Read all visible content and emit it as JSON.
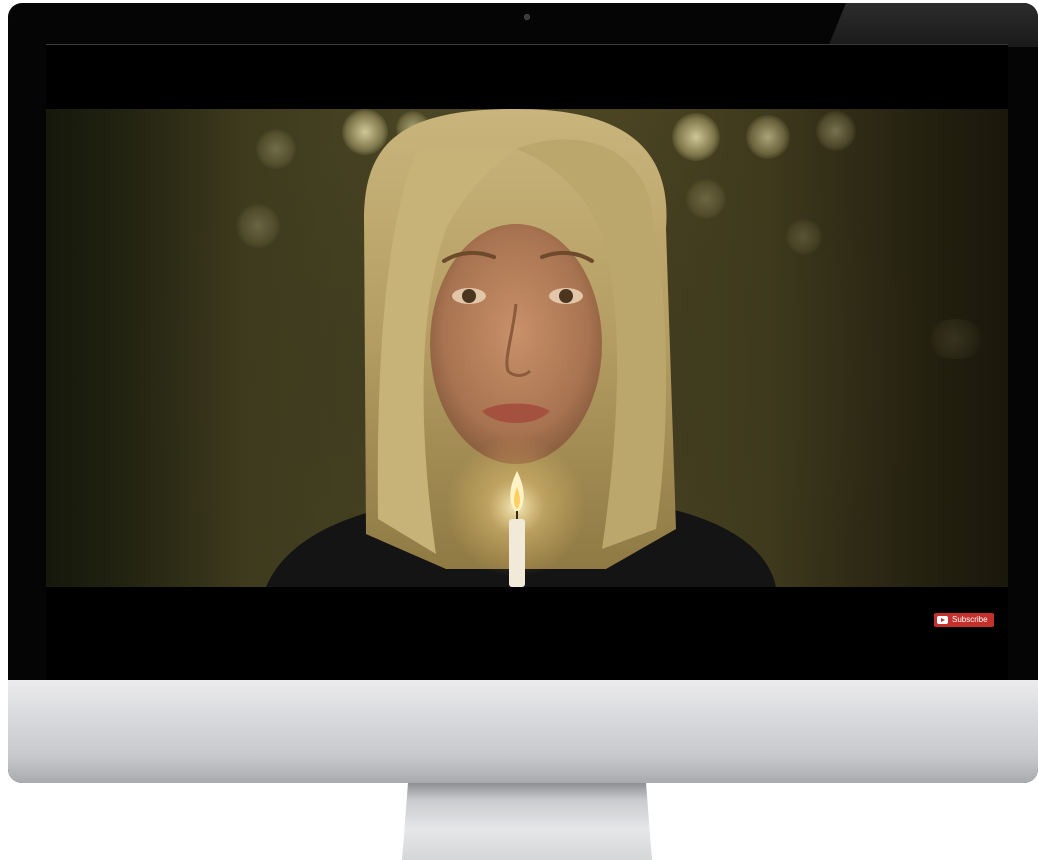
{
  "video_player": {
    "subscribe_label": "Subscribe",
    "subscribe_color": "#c4302b",
    "subscribe_icon": "youtube-play-icon"
  },
  "video_frame": {
    "subject": "woman-with-candle-icon"
  },
  "device": {
    "type": "desktop-monitor",
    "bezel_color": "#050505",
    "chin_color": "#d9dadd"
  }
}
